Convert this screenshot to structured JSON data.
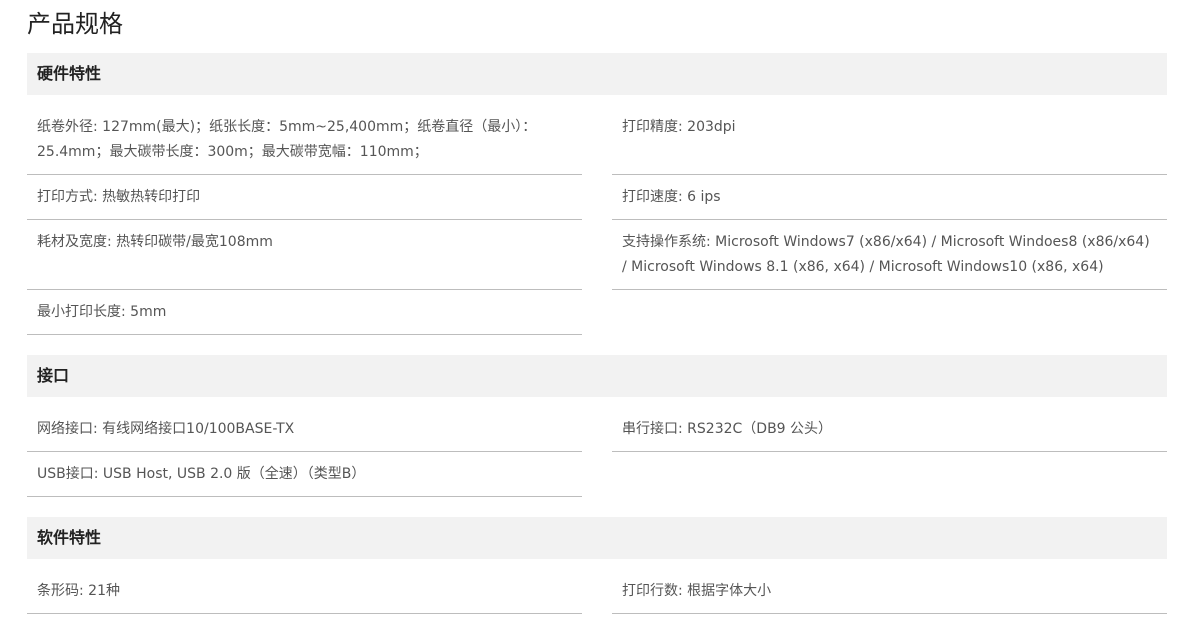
{
  "page_title": "产品规格",
  "sections": [
    {
      "title": "硬件特性",
      "specs": [
        {
          "label": "纸卷外径:",
          "value": "127mm(最大)；纸张长度：5mm~25,400mm；纸卷直径（最小）：25.4mm；最大碳带长度：300m；最大碳带宽幅：110mm；"
        },
        {
          "label": "打印精度:",
          "value": "203dpi"
        },
        {
          "label": "打印方式:",
          "value": "热敏热转印打印"
        },
        {
          "label": "打印速度:",
          "value": "6 ips"
        },
        {
          "label": "耗材及宽度:",
          "value": "热转印碳带/最宽108mm"
        },
        {
          "label": "支持操作系统:",
          "value": "Microsoft Windows7 (x86/x64) / Microsoft Windoes8 (x86/x64) / Microsoft Windows 8.1 (x86, x64) / Microsoft Windows10 (x86, x64)"
        },
        {
          "label": "最小打印长度:",
          "value": "5mm"
        }
      ]
    },
    {
      "title": "接口",
      "specs": [
        {
          "label": "网络接口:",
          "value": "有线网络接口10/100BASE-TX"
        },
        {
          "label": "串行接口:",
          "value": "RS232C（DB9 公头）"
        },
        {
          "label": "USB接口:",
          "value": "USB Host, USB 2.0 版（全速）（类型B）"
        }
      ]
    },
    {
      "title": "软件特性",
      "specs": [
        {
          "label": "条形码:",
          "value": "21种"
        },
        {
          "label": "打印行数:",
          "value": "根据字体大小"
        }
      ]
    }
  ]
}
